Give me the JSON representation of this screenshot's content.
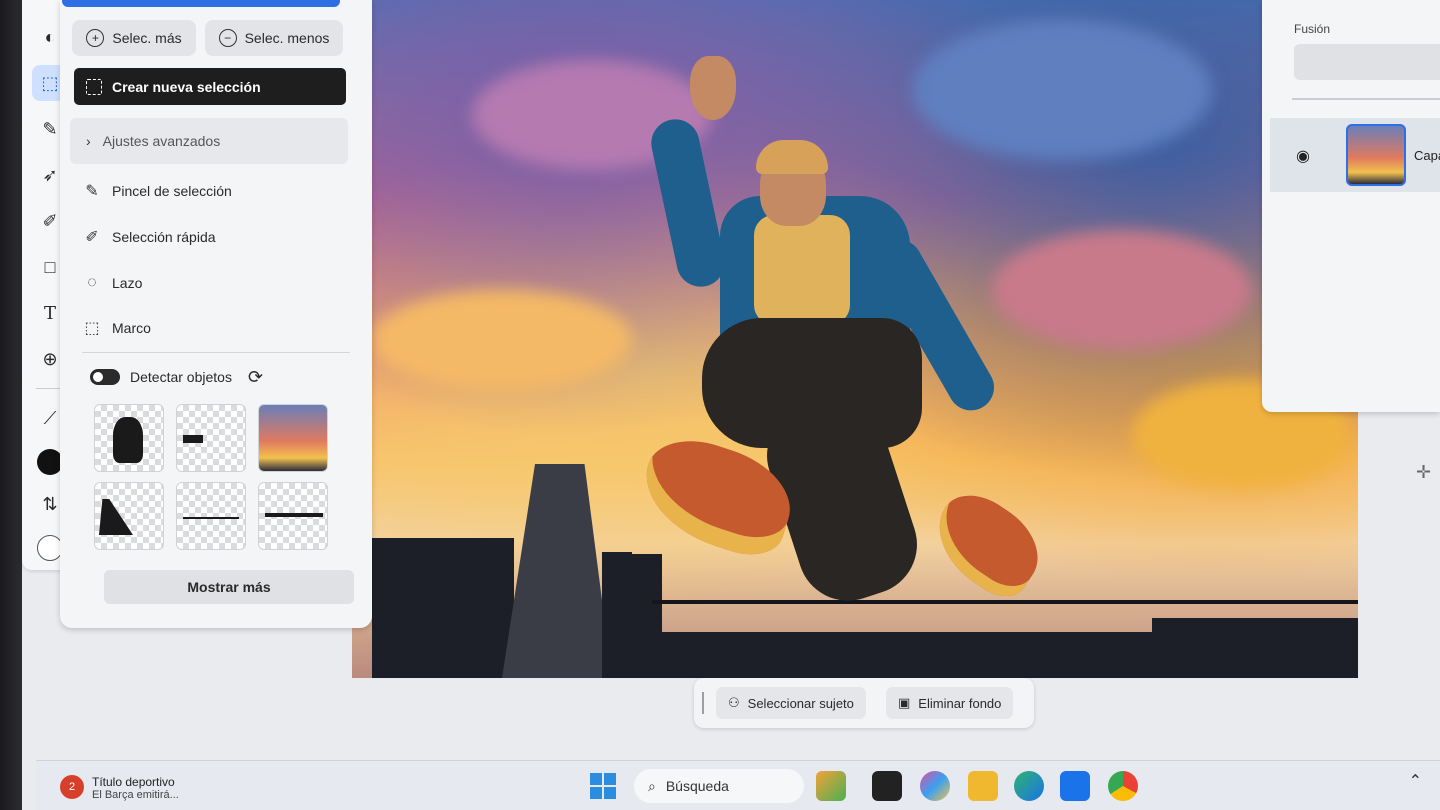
{
  "selection_panel": {
    "add_label": "Selec. más",
    "subtract_label": "Selec. menos",
    "new_selection_label": "Crear nueva selección",
    "advanced_label": "Ajustes avanzados",
    "tools": [
      {
        "label": "Pincel de selección",
        "icon": "selection-brush-icon"
      },
      {
        "label": "Selección rápida",
        "icon": "quick-selection-icon"
      },
      {
        "label": "Lazo",
        "icon": "lasso-icon"
      },
      {
        "label": "Marco",
        "icon": "marquee-icon"
      }
    ],
    "detect_objects_label": "Detectar objetos",
    "detect_objects_on": true,
    "show_more_label": "Mostrar más"
  },
  "canvas_actions": {
    "select_subject_label": "Seleccionar sujeto",
    "remove_background_label": "Eliminar fondo"
  },
  "layers_panel": {
    "blend_label": "Fusión",
    "layer_name": "Capa"
  },
  "taskbar": {
    "news_title": "Título deportivo",
    "news_subtitle": "El Barça emitirá...",
    "news_badge": "2",
    "search_placeholder": "Búsqueda"
  },
  "colors": {
    "accent": "#2f6fe4",
    "foreground_swatch": "#111111",
    "background_swatch": "#ffffff"
  }
}
